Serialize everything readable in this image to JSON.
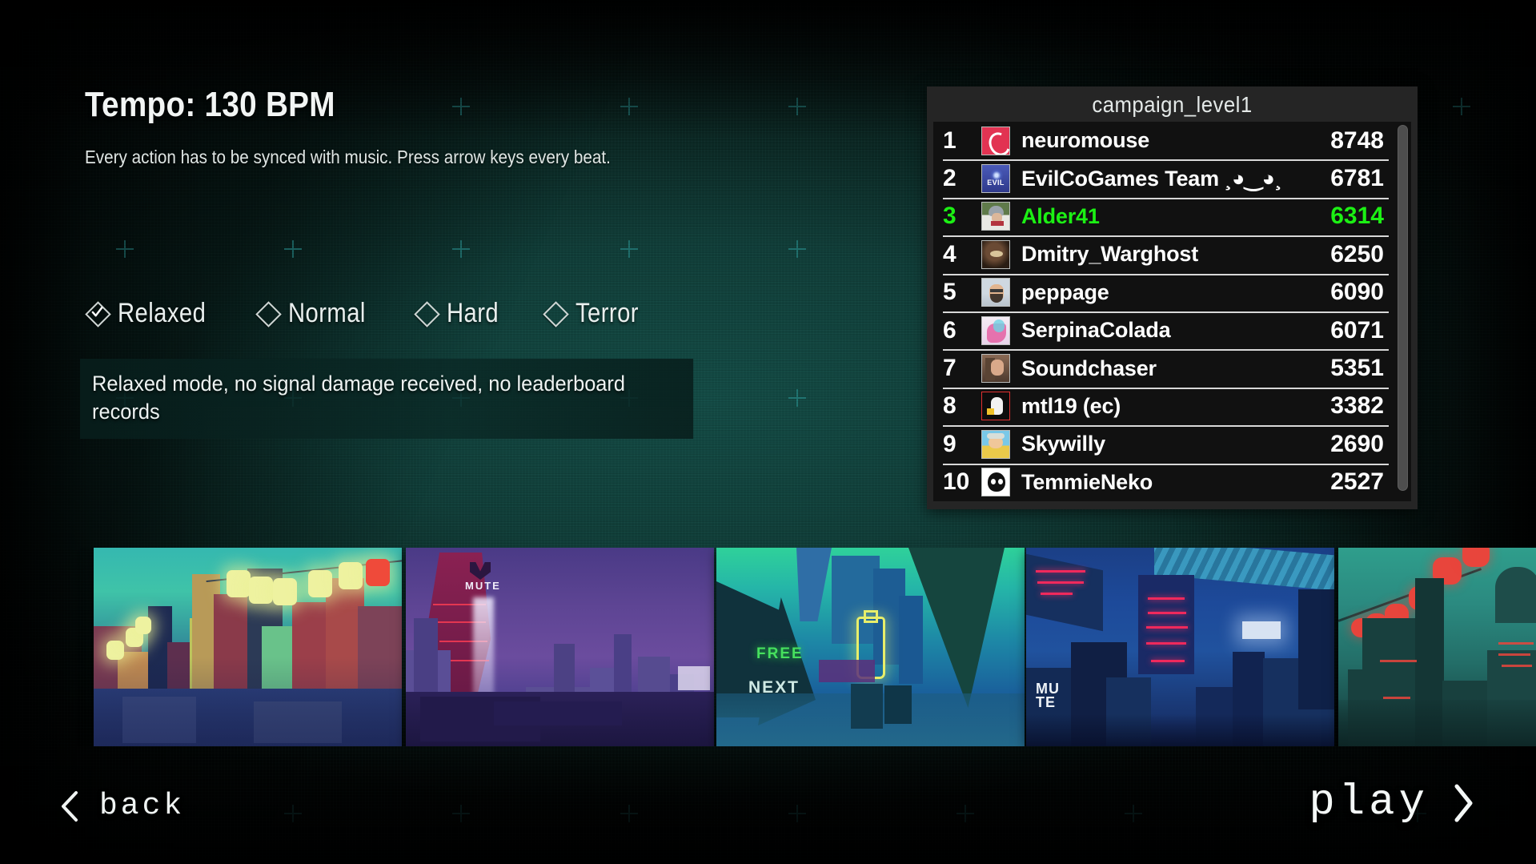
{
  "header": {
    "title": "Tempo: 130 BPM",
    "description": "Every action has to be synced with music. Press arrow keys every beat."
  },
  "difficulty": {
    "selected": "Relaxed",
    "options": [
      {
        "label": "Relaxed",
        "selected": true
      },
      {
        "label": "Normal",
        "selected": false
      },
      {
        "label": "Hard",
        "selected": false
      },
      {
        "label": "Terror",
        "selected": false
      }
    ],
    "description": "Relaxed mode, no signal damage received, no leaderboard records"
  },
  "leaderboard": {
    "title": "campaign_level1",
    "highlight_color": "#1cf014",
    "columns": [
      "rank",
      "avatar",
      "name",
      "score"
    ],
    "rows": [
      {
        "rank": "1",
        "name": "neuromouse",
        "score": "8748",
        "highlighted": false,
        "avatar": "debian-avatar"
      },
      {
        "rank": "2",
        "name": "EvilCoGames Team ¸◕‿◕¸",
        "score": "6781",
        "highlighted": false,
        "avatar": "evil-avatar"
      },
      {
        "rank": "3",
        "name": "Alder41",
        "score": "6314",
        "highlighted": true,
        "avatar": "alder-avatar"
      },
      {
        "rank": "4",
        "name": "Dmitry_Warghost",
        "score": "6250",
        "highlighted": false,
        "avatar": "dmitry-avatar"
      },
      {
        "rank": "5",
        "name": "peppage",
        "score": "6090",
        "highlighted": false,
        "avatar": "peppage-avatar"
      },
      {
        "rank": "6",
        "name": "SerpinaColada",
        "score": "6071",
        "highlighted": false,
        "avatar": "serpina-avatar"
      },
      {
        "rank": "7",
        "name": "Soundchaser",
        "score": "5351",
        "highlighted": false,
        "avatar": "soundchaser-avatar"
      },
      {
        "rank": "8",
        "name": "mtl19 (ec)",
        "score": "3382",
        "highlighted": false,
        "avatar": "mtl19-avatar"
      },
      {
        "rank": "9",
        "name": "Skywilly",
        "score": "2690",
        "highlighted": false,
        "avatar": "skywilly-avatar"
      },
      {
        "rank": "10",
        "name": "TemmieNeko",
        "score": "2527",
        "highlighted": false,
        "avatar": "temmie-avatar"
      }
    ]
  },
  "levels": [
    {
      "id": "level-thumb-1",
      "scene": "teal-sky-lantern-city"
    },
    {
      "id": "level-thumb-2",
      "scene": "purple-mute-tower-city",
      "sign": "MUTE"
    },
    {
      "id": "level-thumb-3",
      "scene": "teal-neon-bottle-city",
      "sign_free": "FREE",
      "sign_next": "NEXT"
    },
    {
      "id": "level-thumb-4",
      "scene": "deep-blue-city",
      "sign": "MU\nTE"
    },
    {
      "id": "level-thumb-5",
      "scene": "green-red-lantern-city"
    }
  ],
  "nav": {
    "back_label": "back",
    "play_label": "play",
    "back_icon": "chevron-left-icon",
    "play_icon": "chevron-right-icon"
  }
}
